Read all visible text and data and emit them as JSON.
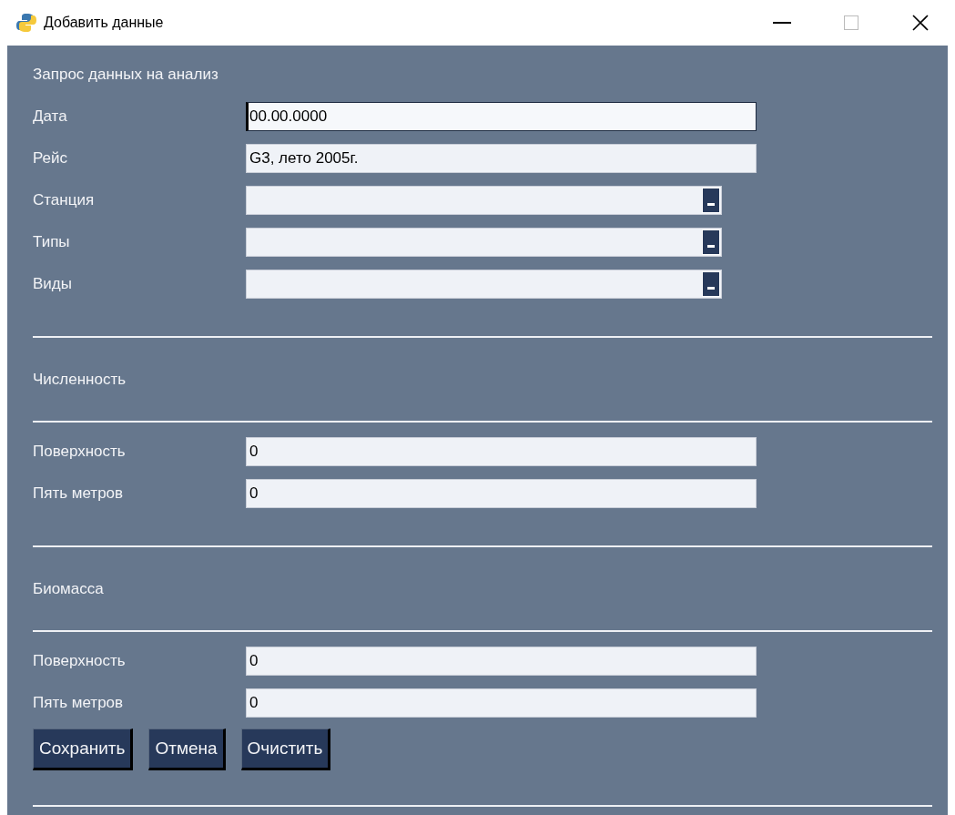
{
  "window": {
    "title": "Добавить данные"
  },
  "heading": "Запрос данных на анализ",
  "fields": [
    {
      "kind": "text",
      "label": "Дата",
      "value": "00.00.0000",
      "focused": true
    },
    {
      "kind": "text",
      "label": "Рейс",
      "value": "G3, лето 2005г.",
      "focused": false
    },
    {
      "kind": "combo",
      "label": "Станция"
    },
    {
      "kind": "combo",
      "label": "Типы"
    },
    {
      "kind": "combo",
      "label": "Виды"
    }
  ],
  "sections": [
    {
      "title": "Численность",
      "fields": [
        {
          "kind": "text",
          "label": "Поверхность",
          "value": "0",
          "focused": false
        },
        {
          "kind": "text",
          "label": "Пять метров",
          "value": "0",
          "focused": false
        }
      ]
    },
    {
      "title": "Биомасса",
      "fields": [
        {
          "kind": "text",
          "label": "Поверхность",
          "value": "0",
          "focused": false
        },
        {
          "kind": "text",
          "label": "Пять метров",
          "value": "0",
          "focused": false
        }
      ]
    }
  ],
  "buttons": [
    "Сохранить",
    "Отмена",
    "Очистить"
  ]
}
